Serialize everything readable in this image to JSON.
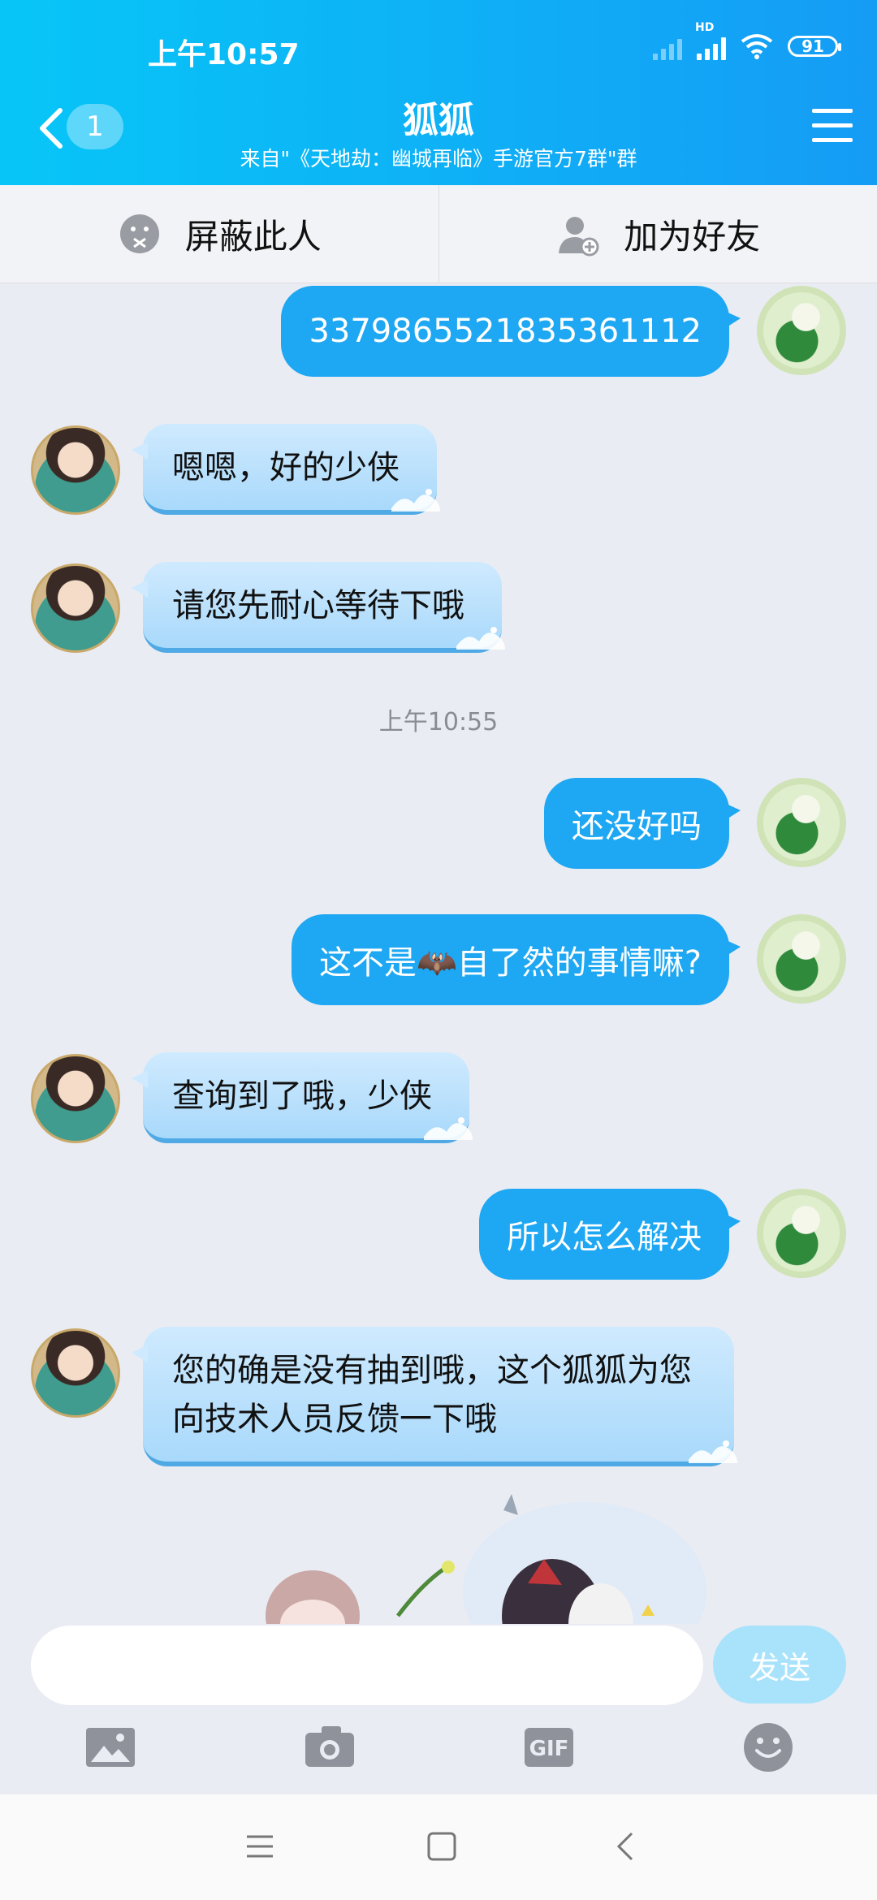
{
  "status_bar": {
    "time": "上午10:57",
    "battery": "91"
  },
  "header": {
    "back_badge": "1",
    "title": "狐狐",
    "subtitle": "来自\"《天地劫：幽城再临》手游官方7群\"群"
  },
  "actions": {
    "block": "屏蔽此人",
    "add_friend": "加为好友"
  },
  "messages": [
    {
      "from": "self",
      "text": "3379865521835361112"
    },
    {
      "from": "other",
      "text": "嗯嗯，好的少侠"
    },
    {
      "from": "other",
      "text": "请您先耐心等待下哦"
    },
    {
      "from": "self",
      "text": "还没好吗"
    },
    {
      "from": "self",
      "text": "这不是🦇自了然的事情嘛?"
    },
    {
      "from": "other",
      "text": "查询到了哦，少侠"
    },
    {
      "from": "self",
      "text": "所以怎么解决"
    },
    {
      "from": "other",
      "text": "您的确是没有抽到哦，这个狐狐为您向技术人员反馈一下哦"
    }
  ],
  "timestamp": "上午10:55",
  "composer": {
    "placeholder": "",
    "send": "发送"
  },
  "toolbar_icons": [
    "image-icon",
    "camera-icon",
    "gif-icon",
    "emoji-icon"
  ],
  "colors": {
    "header_start": "#07c6f7",
    "header_end": "#159cf5",
    "bubble_out": "#1ea7f2",
    "bubble_in": "#bfe3fd"
  }
}
